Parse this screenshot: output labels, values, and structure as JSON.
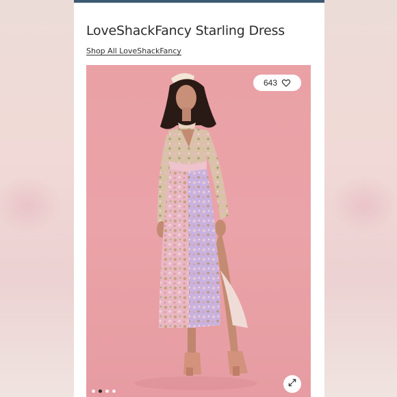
{
  "product": {
    "title": "LoveShackFancy Starling Dress",
    "shop_link": "Shop All LoveShackFancy"
  },
  "photo": {
    "likes_count": "643",
    "likes_icon": "heart-icon",
    "expand_icon": "expand-icon",
    "carousel_dots": 4,
    "active_dot": 2
  },
  "colors": {
    "top_bar": "#3e5a73",
    "photo_background": "#e9a1a6",
    "text": "#2b2b2b"
  }
}
